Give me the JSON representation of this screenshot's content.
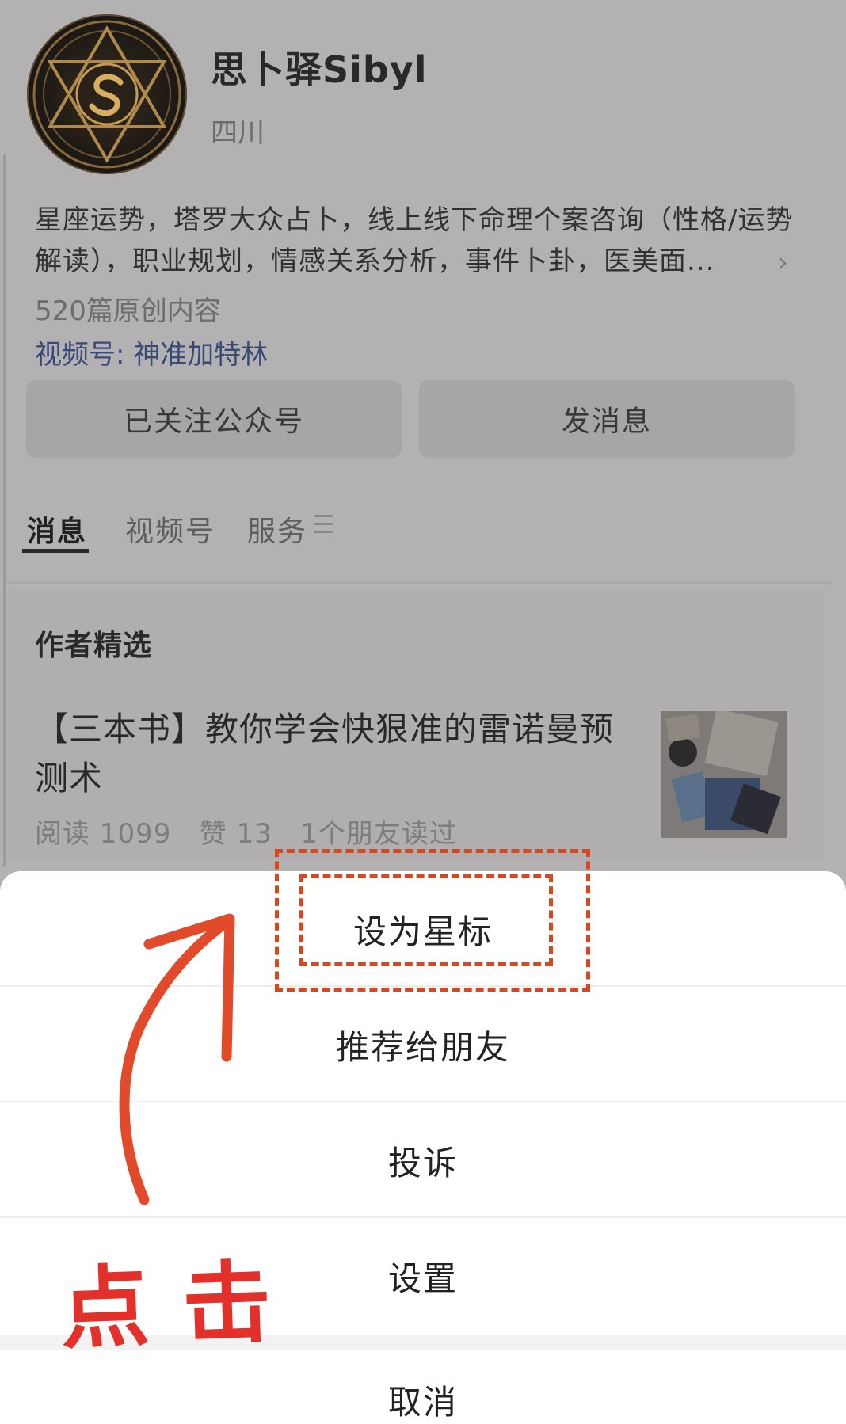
{
  "profile": {
    "name": "思卜驿Sibyl",
    "region": "四川",
    "description": "星座运势，塔罗大众占卜，线上线下命理个案咨询（性格/运势解读），职业规划，情感关系分析，事件卜卦，医美面...",
    "original_count": "520篇原创内容",
    "video_channel": "视频号: 神准加特林"
  },
  "buttons": {
    "followed": "已关注公众号",
    "message": "发消息"
  },
  "tabs": [
    {
      "label": "消息",
      "active": true
    },
    {
      "label": "视频号",
      "active": false
    },
    {
      "label": "服务",
      "active": false
    }
  ],
  "featured": {
    "section_title": "作者精选",
    "article": {
      "title": "【三本书】教你学会快狠准的雷诺曼预测术",
      "reads": "阅读 1099",
      "likes": "赞 13",
      "friends": "1个朋友读过"
    }
  },
  "action_sheet": {
    "items": [
      "设为星标",
      "推荐给朋友",
      "投诉",
      "设置"
    ],
    "cancel": "取消"
  },
  "annotation": {
    "text": "点击",
    "color": "#e2312a"
  },
  "icons": [
    "avatar-logo",
    "chevron-right-icon",
    "menu-icon",
    "arrow-annotation"
  ]
}
